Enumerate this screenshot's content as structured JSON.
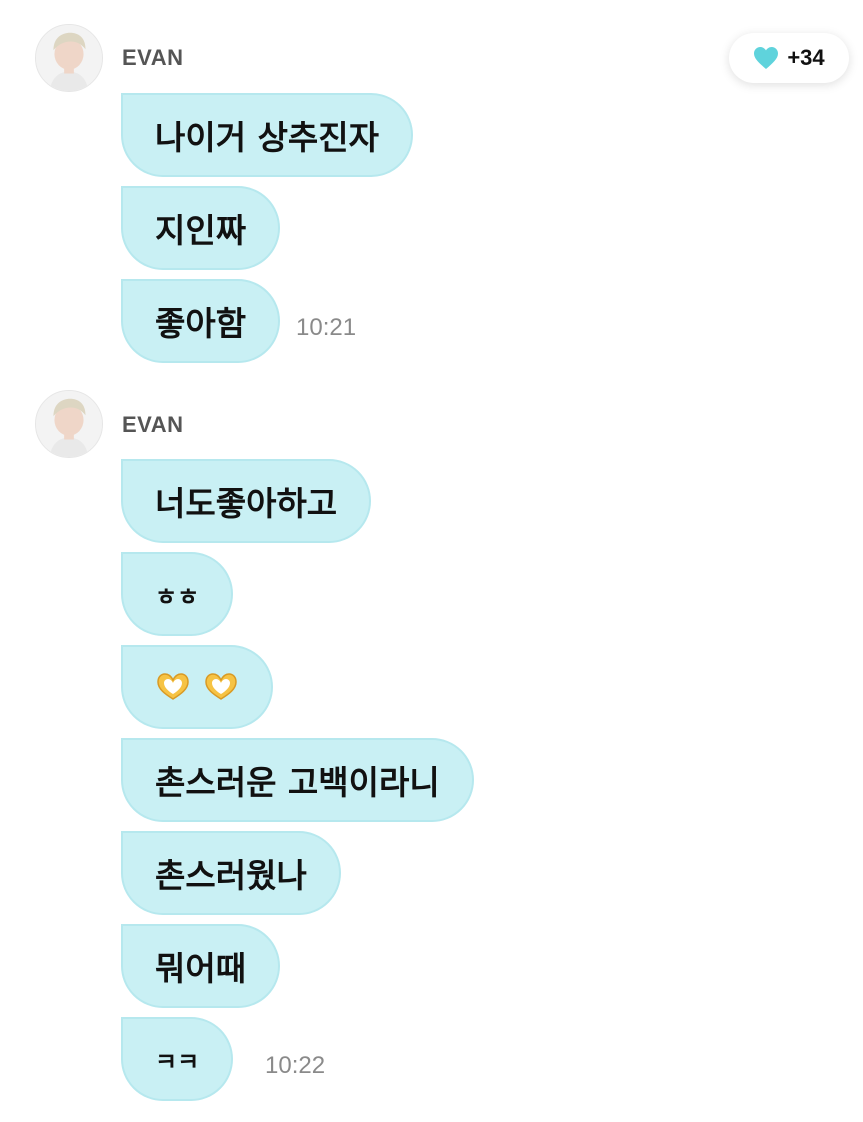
{
  "reactions": {
    "heart_icon": "heart-icon",
    "count": "+34",
    "heart_color": "#5fd3dc"
  },
  "groups": [
    {
      "sender": "EVAN",
      "messages": [
        {
          "text": "나이거 상추진자"
        },
        {
          "text": "지인짜"
        },
        {
          "text": "좋아함",
          "time": "10:21"
        }
      ]
    },
    {
      "sender": "EVAN",
      "messages": [
        {
          "text": "너도좋아하고"
        },
        {
          "text": "ㅎㅎ"
        },
        {
          "emoji": "heart-hands-emoji x2"
        },
        {
          "text": "촌스러운 고백이라니"
        },
        {
          "text": "촌스러웠나"
        },
        {
          "text": "뭐어때"
        },
        {
          "text": "ㅋㅋ",
          "time": "10:22"
        }
      ]
    }
  ],
  "colors": {
    "bubble": "#c9f0f4",
    "bubble_border": "#b6e8ee",
    "time": "#8a8a8a",
    "sender": "#555555"
  }
}
